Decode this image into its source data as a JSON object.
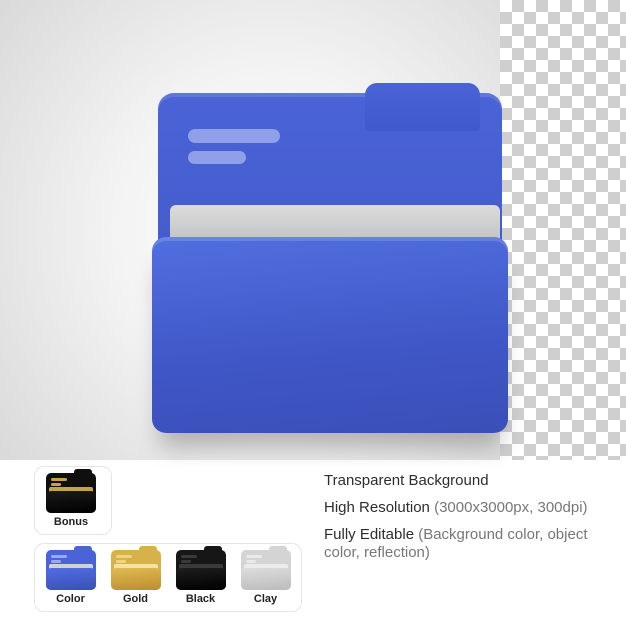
{
  "bonus": {
    "label": "Bonus"
  },
  "variants": {
    "color": "Color",
    "gold": "Gold",
    "black": "Black",
    "clay": "Clay"
  },
  "features": {
    "f1": "Transparent Background",
    "f2_main": "High Resolution",
    "f2_detail": "(3000x3000px, 300dpi)",
    "f3_main": "Fully Editable",
    "f3_detail": "(Background color, object color, reflection)"
  }
}
